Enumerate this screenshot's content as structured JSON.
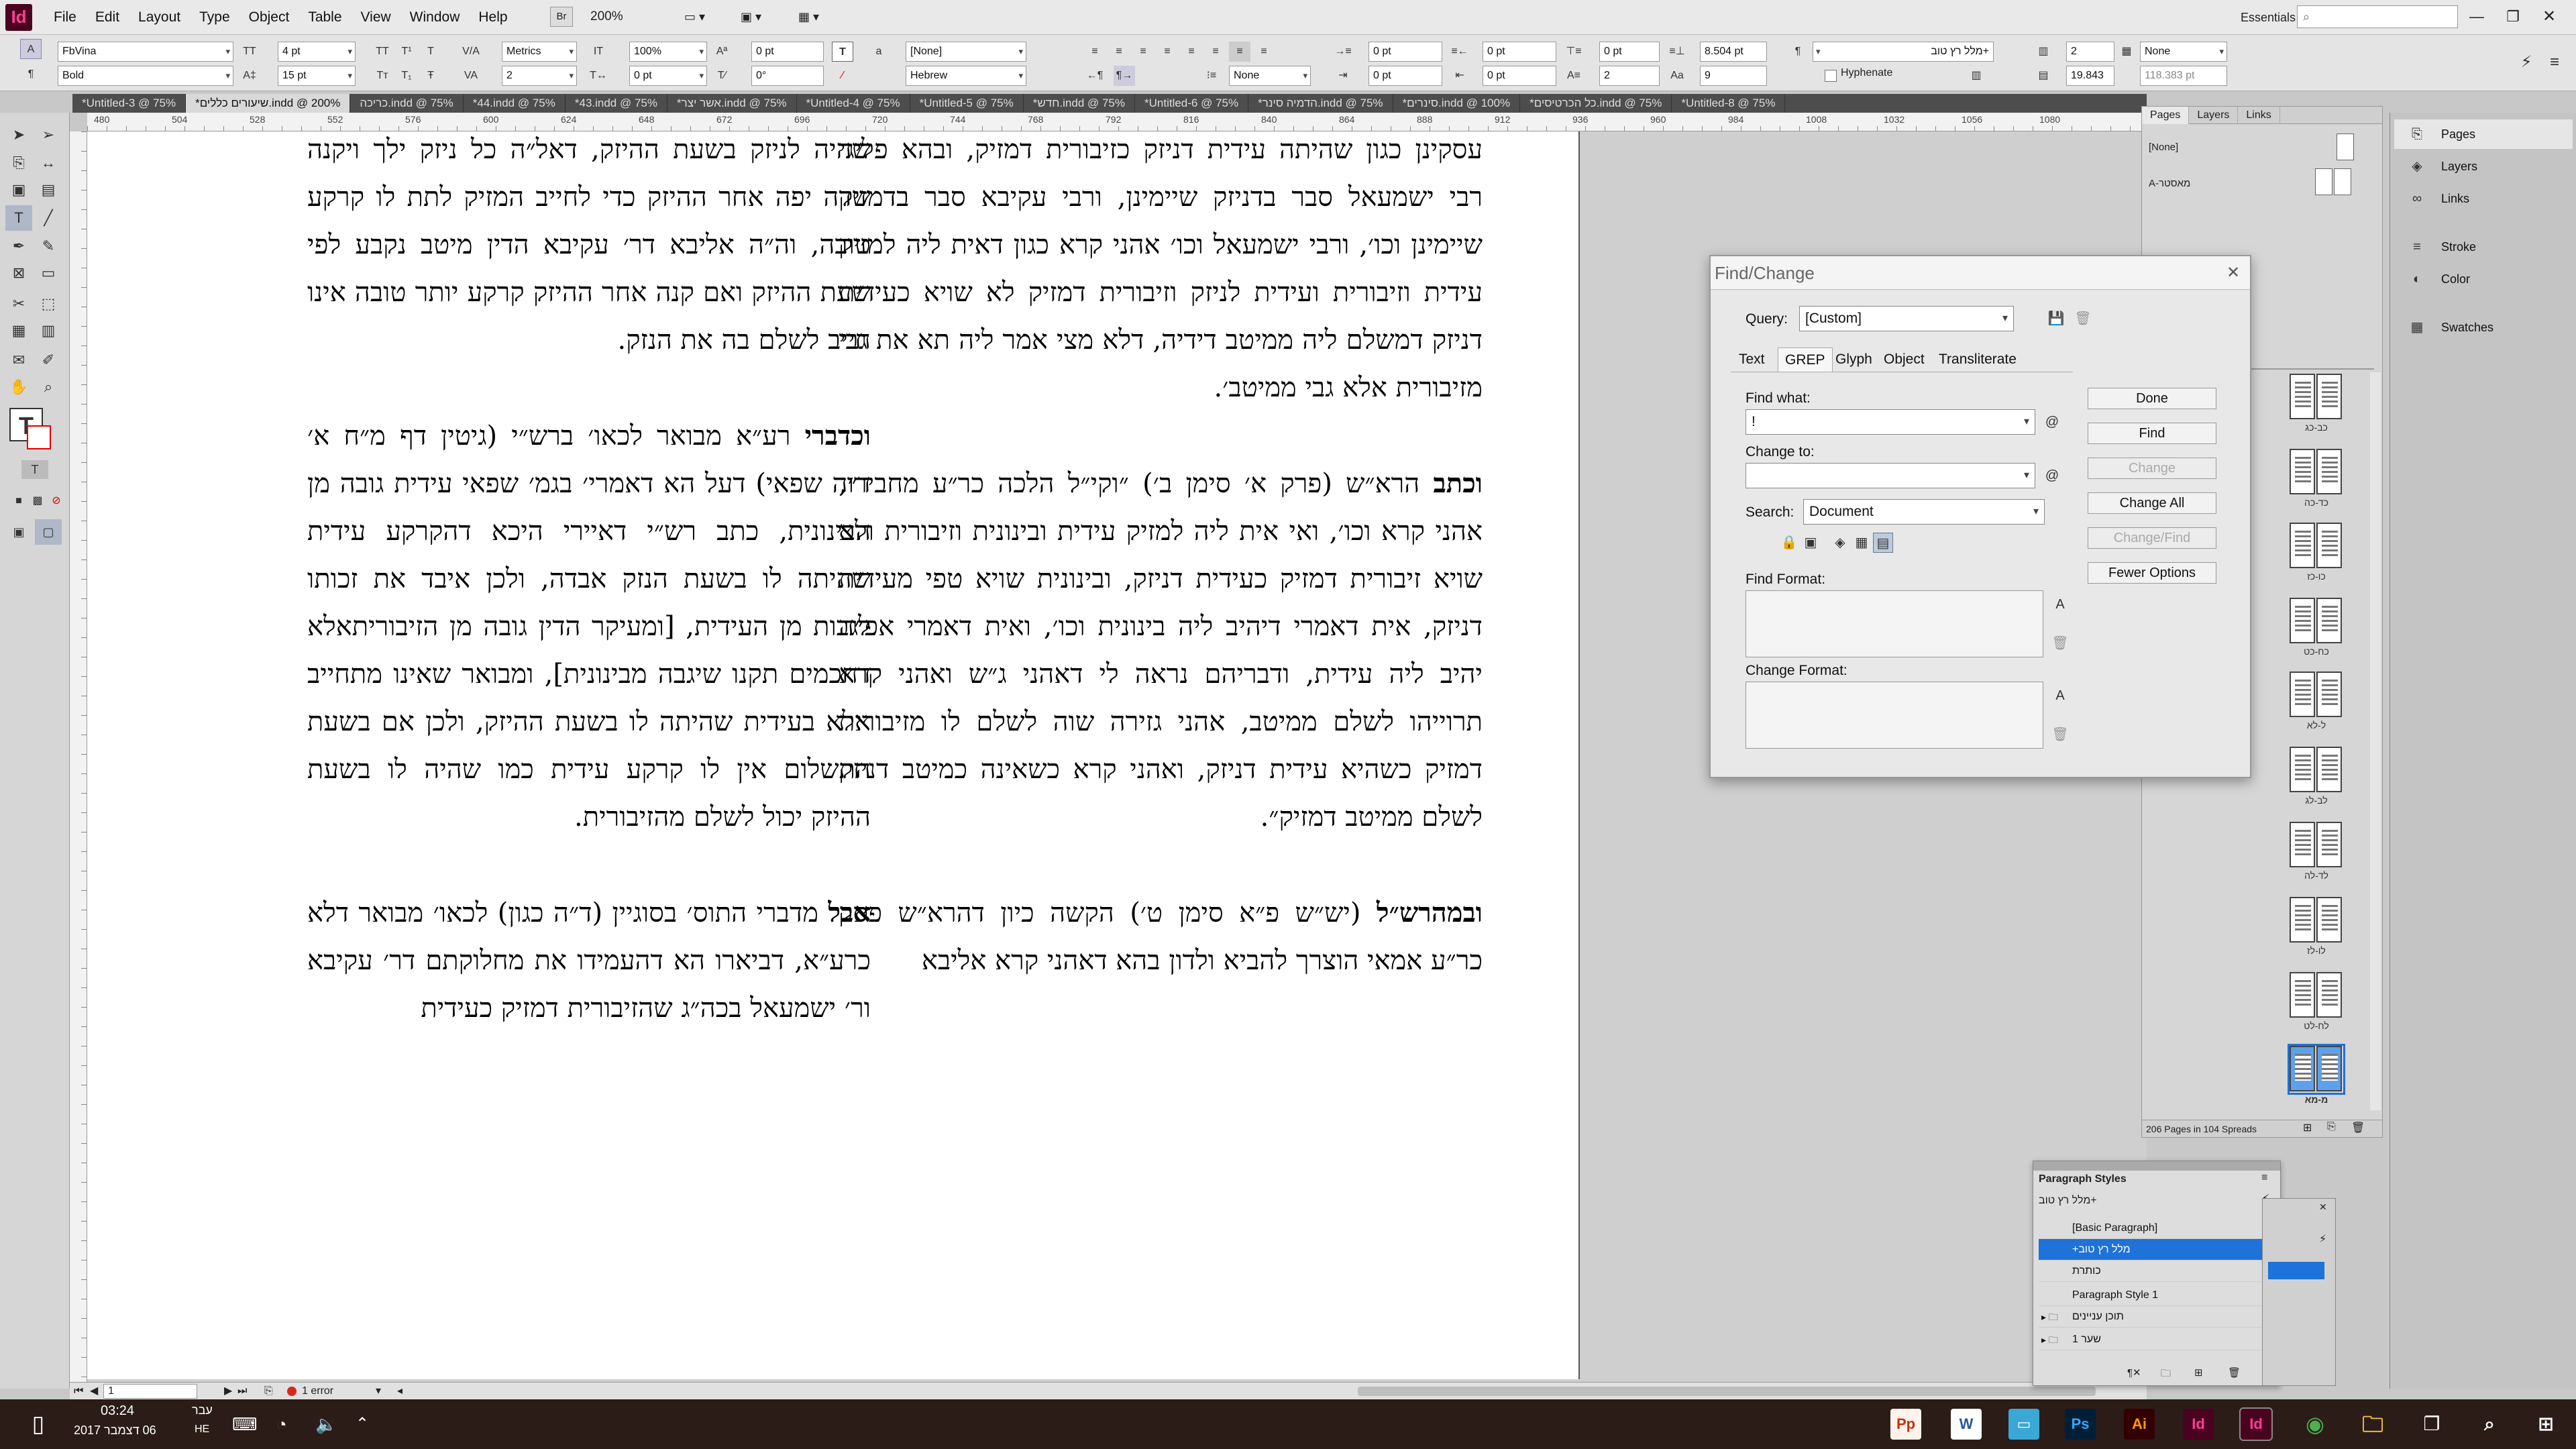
{
  "menubar": {
    "app_icon": "Id",
    "items": [
      "File",
      "Edit",
      "Layout",
      "Type",
      "Object",
      "Table",
      "View",
      "Window",
      "Help"
    ],
    "zoom": "200%",
    "workspace": "Essentials"
  },
  "control": {
    "font": "FbVina",
    "style": "Bold",
    "size1": "4 pt",
    "size2": "15 pt",
    "kerning": "Metrics",
    "scale1": "100%",
    "scale2": "100%",
    "angle": "0°",
    "char_style": "[None]",
    "language": "Hebrew",
    "indent1": "0 pt",
    "indent2": "0 pt",
    "indent3": "0 pt",
    "indent4": "0 pt",
    "space1": "0 pt",
    "space2": "8.504 pt",
    "drop1": "2",
    "drop2": "9",
    "para_style": "+מלל רץ טוב",
    "hyphenate": "Hyphenate",
    "none": "None",
    "cols": "2",
    "gutter": "19.843",
    "width": "118.383 pt",
    "pt_none": "None"
  },
  "tabs": [
    "*Untitled-3 @ 75%",
    "*שיעורים כללים.indd @ 200%",
    "כריכה.indd @ 75%",
    "*44.indd @ 75%",
    "*43.indd @ 75%",
    "*אשר יצר.indd @ 75%",
    "*Untitled-4 @ 75%",
    "*Untitled-5 @ 75%",
    "*חדש.indd @ 75%",
    "*Untitled-6 @ 75%",
    "*הדמיה סינר.indd @ 75%",
    "*סינרים.indd @ 100%",
    "*כל הכרטיסים.indd @ 75%",
    "*Untitled-8 @ 75%"
  ],
  "ruler": [
    "480",
    "504",
    "528",
    "552",
    "576",
    "600",
    "624",
    "648",
    "672",
    "696",
    "720",
    "744",
    "768",
    "792",
    "816",
    "840",
    "864",
    "888",
    "912",
    "936",
    "960",
    "984",
    "1008",
    "1032",
    "1056",
    "1080"
  ],
  "document": {
    "right_col": [
      {
        "html": "עסקינן כגון שהיתה עידית דניזק כזיבורית דמזיק, ובהא פליגי רבי ישמעאל סבר בדניזק שיימינן, ורבי עקיבא סבר בדמזיק שיימינן וכו׳, ורבי ישמעאל וכו׳ אהני קרא כגון דאית ליה למזיק עידית וזיבורית ועידית לניזק וזיבורית דמזיק לא שויא כעידית דניזק דמשלם ליה ממיטב דידיה, דלא מצי אמר ליה תא את גבי מזיבורית אלא גבי ממיטב׳."
      },
      {
        "lead": "וכתב",
        "html": "הרא״ש (פרק א׳ סימן ב׳) ״וקי״ל הלכה כר״ע מחבירו, אהני קרא וכו׳, ואי אית ליה למזיק עידית ובינונית וזיבורית ולא שויא זיבורית דמזיק כעידית דניזק, ובינונית שויא טפי מעידית דניזק, אית דאמרי דיהיב ליה בינונית וכו׳, ואית דאמרי אפ״ה יהיב ליה עידית, ודבריהם נראה לי דאהני ג״ש ואהני קרא תרוייהו לשלם ממיטב, אהני גזירה שוה לשלם לו מזיבורית דמזיק כשהיא עידית דניזק, ואהני קרא כשאינה כמיטב דניזק לשלם ממיטב דמזיק״."
      },
      {
        "lead": "ובמהרש״ל",
        "html": "(יש״ש פ״א סימן ט׳) הקשה כיון דהרא״ש פסק כר״ע אמאי הוצרך להביא ולדון בהא דאהני קרא אליבא"
      }
    ],
    "left_col": [
      {
        "html": "שהיה לניזק בשעת ההיזק, דאל״ה כל ניזק ילך ויקנה שדה יפה אחר ההיזק כדי לחייב המזיק לתת לו קרקע טובה, וה״ה אליבא דר׳ עקיבא הדין מיטב נקבע לפי שעת ההיזק ואם קנה אחר ההיזק קרקע יותר טובה אינו חייב לשלם בה את הנזק."
      },
      {
        "lead": "וכדברי",
        "html": "רע״א מבואר לכאו׳ ברש״י (גיטין דף מ״ח א׳ ד״ה שפאי) דעל הא דאמרי׳ בגמ׳ שפאי עידית גובה מן הבינונית, כתב רש״י דאיירי היכא דהקרקע עידית שהיתה לו בשעת הנזק אבדה, ולכן איבד את זכותו לגבות מן העידית, [ומעיקר הדין גובה מן הזיבוריתאלא דחכמים תקנו שיגבה מבינונית], ומבואר שאינו מתחייב אלא בעידית שהיתה לו בשעת ההיזק, ולכן אם בשעת התשלום אין לו קרקע עידית כמו שהיה לו בשעת ההיזק יכול לשלם מהזיבורית."
      },
      {
        "lead": "אבל",
        "html": "מדברי התוס׳ בסוגיין (ד״ה כגון) לכאו׳ מבואר דלא כרע״א, דביארו הא דהעמידו את מחלוקתם דר׳ עקיבא ור׳ ישמעאל בכה״ג שהזיבורית דמזיק כעידית"
      }
    ]
  },
  "status": {
    "page": "1",
    "error": "1 error"
  },
  "pages_panel": {
    "tabs": [
      "Pages",
      "Layers",
      "Links"
    ],
    "none": "[None]",
    "master": "A-מאסטר",
    "summary": "206 Pages in 104 Spreads",
    "thumb_labels": [
      "כב-כג",
      "כד-כה",
      "כו-כז",
      "כח-כט",
      "ל-לא",
      "לב-לג",
      "לד-לה",
      "לו-לז",
      "לח-לט",
      "מ-מא"
    ]
  },
  "right_dock": {
    "buttons": [
      "Pages",
      "Layers",
      "Links",
      "Stroke",
      "Color",
      "Swatches"
    ]
  },
  "find_change": {
    "title": "Find/Change",
    "query_label": "Query:",
    "query_value": "[Custom]",
    "tabs": [
      "Text",
      "GREP",
      "Glyph",
      "Object",
      "Transliterate"
    ],
    "find_label": "Find what:",
    "find_value": "!",
    "change_label": "Change to:",
    "change_value": "",
    "search_label": "Search:",
    "search_value": "Document",
    "find_format": "Find Format:",
    "change_format": "Change Format:",
    "buttons": [
      "Done",
      "Find",
      "Change",
      "Change All",
      "Change/Find",
      "Fewer Options"
    ]
  },
  "paragraph_styles": {
    "title": "Paragraph Styles",
    "current": "+מלל רץ טוב",
    "items": [
      "[Basic Paragraph]",
      "+מלל רץ טוב",
      "כותרת",
      "Paragraph Style 1",
      "תוכן עניינים",
      "שער 1"
    ]
  },
  "taskbar": {
    "time": "03:24",
    "date": "06 דצמבר 2017",
    "lang": "עבר",
    "lang2": "HE",
    "apps": [
      "Pp",
      "W",
      "Ps",
      "Ai",
      "Id",
      "Id"
    ]
  }
}
